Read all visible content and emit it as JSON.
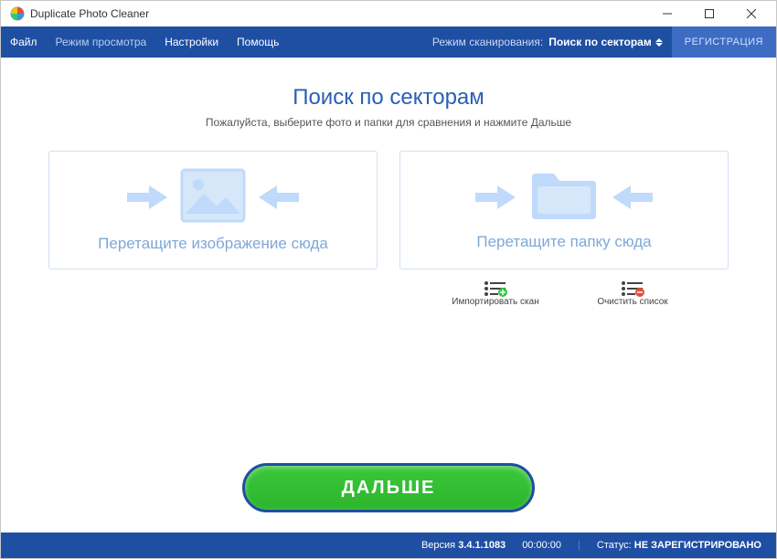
{
  "titlebar": {
    "title": "Duplicate Photo Cleaner"
  },
  "menu": {
    "file": "Файл",
    "view_mode": "Режим просмотра",
    "settings": "Настройки",
    "help": "Помощь",
    "scan_mode_label": "Режим сканирования:",
    "scan_mode_value": "Поиск по секторам",
    "registration": "РЕГИСТРАЦИЯ"
  },
  "main": {
    "heading": "Поиск по секторам",
    "subheading": "Пожалуйста, выберите фото и папки для сравнения и нажмите Дальше",
    "drop_image": "Перетащите изображение сюда",
    "drop_folder": "Перетащите папку сюда",
    "import_scan": "Импортировать скан",
    "clear_list": "Очистить список",
    "next": "ДАЛЬШЕ"
  },
  "status": {
    "version_label": "Версия",
    "version_value": "3.4.1.1083",
    "time": "00:00:00",
    "status_label": "Статус:",
    "status_value": "НЕ ЗАРЕГИСТРИРОВАНО"
  }
}
